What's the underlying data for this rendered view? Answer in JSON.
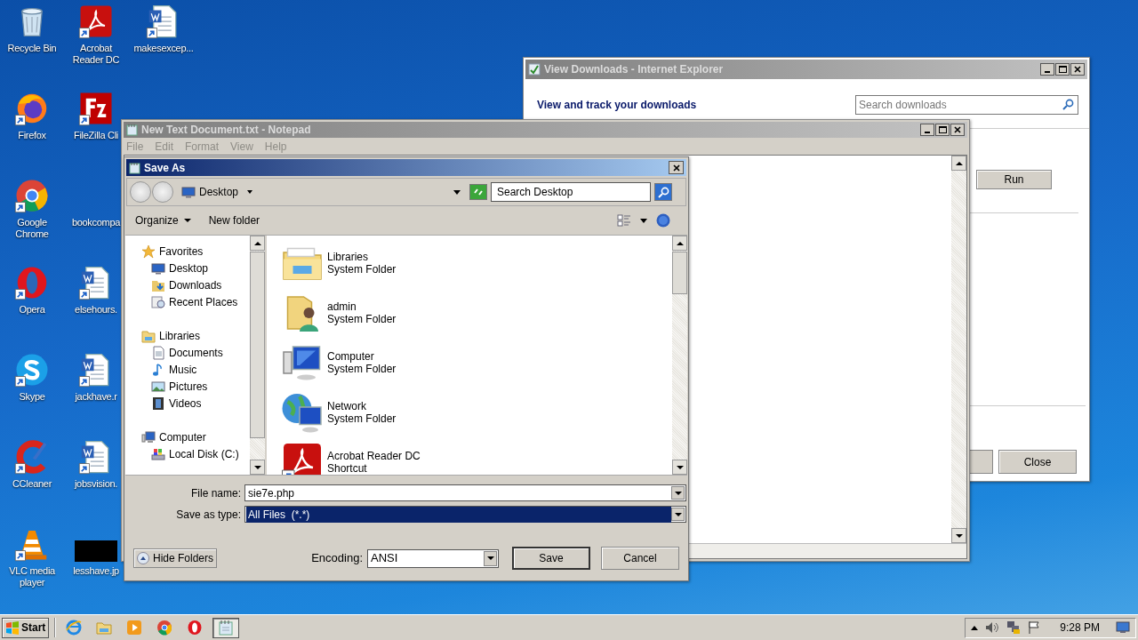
{
  "desktop_icons": [
    {
      "label": "Recycle Bin",
      "kind": "recycle"
    },
    {
      "label": "Firefox",
      "kind": "firefox"
    },
    {
      "label": "Google Chrome",
      "kind": "chrome"
    },
    {
      "label": "Opera",
      "kind": "opera"
    },
    {
      "label": "Skype",
      "kind": "skype"
    },
    {
      "label": "CCleaner",
      "kind": "ccleaner"
    },
    {
      "label": "VLC media player",
      "kind": "vlc"
    },
    {
      "label": "Acrobat Reader DC",
      "kind": "acrobat"
    },
    {
      "label": "FileZilla Cli",
      "kind": "filezilla"
    },
    {
      "label": "bookcompa",
      "kind": "blank"
    },
    {
      "label": "elsehours.",
      "kind": "word"
    },
    {
      "label": "jackhave.r",
      "kind": "word"
    },
    {
      "label": "jobsvision.",
      "kind": "word"
    },
    {
      "label": "lesshave.jp",
      "kind": "image"
    },
    {
      "label": "makesexcep...",
      "kind": "word"
    }
  ],
  "ie_window": {
    "title": "View Downloads - Internet Explorer",
    "heading": "View and track your downloads",
    "search": {
      "placeholder": "Search downloads"
    },
    "run_button": "Run",
    "close_button": "Close"
  },
  "notepad": {
    "title": "New Text Document.txt - Notepad",
    "menu": [
      "File",
      "Edit",
      "Format",
      "View",
      "Help"
    ]
  },
  "save_as": {
    "title": "Save As",
    "address": "Desktop",
    "search": {
      "placeholder": "Search Desktop"
    },
    "toolbar": [
      "Organize",
      "New folder"
    ],
    "nav": [
      {
        "label": "Favorites",
        "kind": "star",
        "children": [
          {
            "label": "Desktop",
            "kind": "desktop"
          },
          {
            "label": "Downloads",
            "kind": "downloads"
          },
          {
            "label": "Recent Places",
            "kind": "recent"
          }
        ]
      },
      {
        "label": "Libraries",
        "kind": "libraries",
        "children": [
          {
            "label": "Documents",
            "kind": "documents"
          },
          {
            "label": "Music",
            "kind": "music"
          },
          {
            "label": "Pictures",
            "kind": "pictures"
          },
          {
            "label": "Videos",
            "kind": "videos"
          }
        ]
      },
      {
        "label": "Computer",
        "kind": "computer",
        "children": [
          {
            "label": "Local Disk (C:)",
            "kind": "disk"
          }
        ]
      }
    ],
    "files": [
      {
        "name": "Libraries",
        "type": "System Folder",
        "kind": "libraries"
      },
      {
        "name": "admin",
        "type": "System Folder",
        "kind": "user"
      },
      {
        "name": "Computer",
        "type": "System Folder",
        "kind": "computer"
      },
      {
        "name": "Network",
        "type": "System Folder",
        "kind": "network"
      },
      {
        "name": "Acrobat Reader DC",
        "type": "Shortcut",
        "kind": "acrobat"
      }
    ],
    "fields": [
      {
        "label": "File name:",
        "value": "sie7e.php",
        "selected": false
      },
      {
        "label": "Save as type:",
        "value": "All Files  (*.*)",
        "selected": true
      }
    ],
    "hide_folders": "Hide Folders",
    "encoding_label": "Encoding:",
    "encoding": "ANSI",
    "save_button": "Save",
    "cancel_button": "Cancel"
  },
  "taskbar": {
    "start": "Start",
    "apps": [
      {
        "kind": "ie",
        "selected": false
      },
      {
        "kind": "explorer",
        "selected": false
      },
      {
        "kind": "media",
        "selected": false
      },
      {
        "kind": "chrome",
        "selected": false
      },
      {
        "kind": "opera",
        "selected": false
      },
      {
        "kind": "notepad",
        "selected": true
      }
    ],
    "clock": "9:28 PM"
  }
}
